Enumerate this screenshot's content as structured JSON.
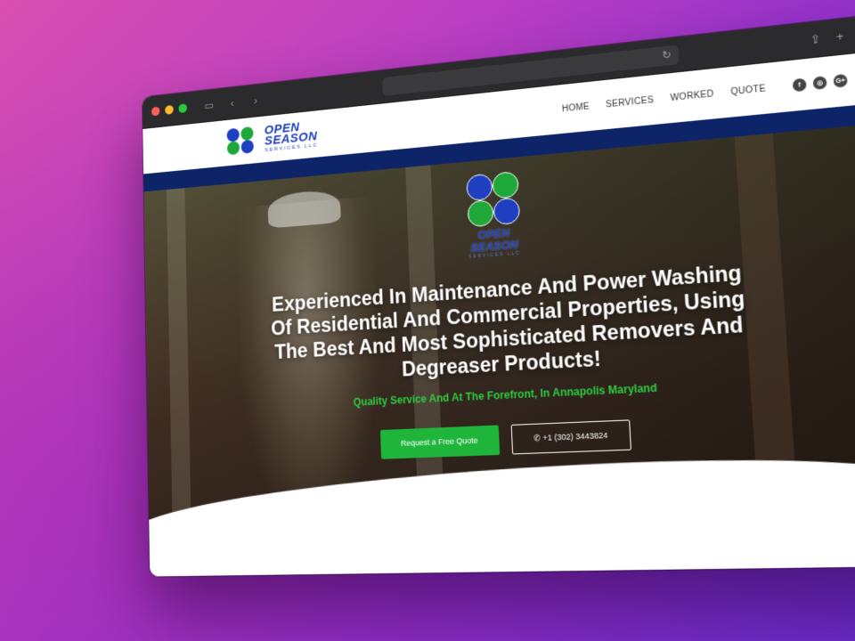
{
  "browser": {
    "icons": [
      "sidebar-icon",
      "back-icon",
      "forward-icon",
      "reload-icon",
      "share-icon",
      "new-tab-icon",
      "tabs-overview-icon"
    ]
  },
  "header": {
    "logo": {
      "line1": "OPEN",
      "line2": "SEASON",
      "line3": "SERVICES LLC"
    },
    "nav": [
      "HOME",
      "SERVICES",
      "WORKED",
      "QUOTE"
    ],
    "social": [
      {
        "icon": "facebook-icon",
        "glyph": "f"
      },
      {
        "icon": "instagram-icon",
        "glyph": "◎"
      },
      {
        "icon": "google-plus-icon",
        "glyph": "G+"
      }
    ]
  },
  "hero": {
    "logo": {
      "line1": "OPEN",
      "line2": "SEASON",
      "line3": "SERVICES LLC"
    },
    "headline": "Experienced In Maintenance And Power Washing Of Residential And Commercial Properties, Using The Best And Most Sophisticated Removers And Degreaser Products!",
    "tagline": "Quality Service And At The Forefront, In Annapolis Maryland",
    "cta_quote": "Request a Free Quote",
    "cta_phone": "+1 (302) 3443824",
    "phone_icon": "phone-icon"
  },
  "colors": {
    "brand_blue": "#1e3fbf",
    "brand_green": "#2ecc40",
    "navy_bar": "#0e2469",
    "cta_green": "#1fb53b"
  }
}
